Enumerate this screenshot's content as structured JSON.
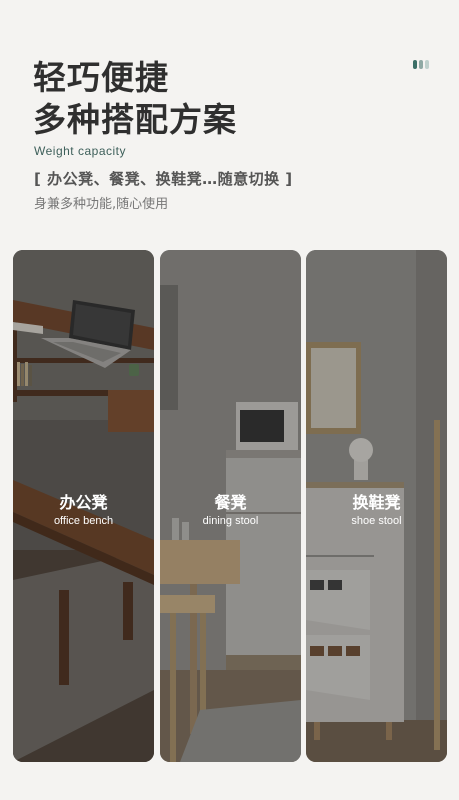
{
  "header": {
    "title_line1": "轻巧便捷",
    "title_line2": "多种搭配方案",
    "subtitle_en": "Weight capacity",
    "usage_line": "[ 办公凳、餐凳、换鞋凳…随意切换 ]",
    "description": "身兼多种功能,随心使用"
  },
  "colors": {
    "accent": "#3d5f5a",
    "title": "#2f2f2f"
  },
  "panels": [
    {
      "label_cn": "办公凳",
      "label_en": "office bench"
    },
    {
      "label_cn": "餐凳",
      "label_en": "dining stool"
    },
    {
      "label_cn": "换鞋凳",
      "label_en": "shoe stool"
    }
  ]
}
